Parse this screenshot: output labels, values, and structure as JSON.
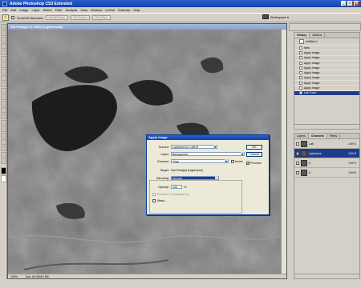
{
  "app": {
    "title": "Adobe Photoshop CS3 Extended",
    "window_controls": [
      "_",
      "□",
      "x"
    ]
  },
  "menu": [
    "File",
    "Edit",
    "Image",
    "Layer",
    "Select",
    "Filter",
    "Analysis",
    "View",
    "Window",
    "onOne",
    "Extensis",
    "Help"
  ],
  "options": {
    "scroll_all_windows": "Scroll All Windows",
    "actual_pixels": "Actual Pixels",
    "fit_screen": "Fit Screen",
    "print_size": "Print Size",
    "workspace": "Workspace ▾"
  },
  "document": {
    "title": "Sat Finaljpd @ 100% (Lightness/8)",
    "status_zoom": "100%",
    "status_doc": "Doc: 63.2M/8.13M"
  },
  "dialog": {
    "title": "Apply Image",
    "source_label": "Source:",
    "source_value": "Lightness for LAB.tif",
    "layer_label": "Layer:",
    "layer_value": "Background",
    "channel_label": "Channel:",
    "channel_value": "Gray",
    "invert_label": "Invert",
    "target_label": "Target:",
    "target_value": "Sat Finaljpd (Lightness)",
    "blending_label": "Blending:",
    "blending_value": "Normal",
    "opacity_label": "Opacity:",
    "opacity_value": "100",
    "opacity_unit": "%",
    "preserve_label": "Preserve Transparency",
    "mask_label": "Mask...",
    "ok": "OK",
    "cancel": "Cancel",
    "preview_label": "Preview"
  },
  "history_panel": {
    "tabs": [
      "History",
      "Actions"
    ],
    "snapshot": "Untitled-1",
    "items": [
      "New",
      "Apply Image",
      "Apply Image",
      "Apply Image",
      "Apply Image",
      "Apply Image",
      "Apply Image",
      "Apply Image",
      "Apply Image",
      "Lab Color"
    ],
    "selected_index": 9
  },
  "channels_panel": {
    "tabs": [
      "Layers",
      "Channels",
      "Paths"
    ],
    "rows": [
      {
        "name": "Lab",
        "key": "Ctrl+2"
      },
      {
        "name": "Lightness",
        "key": "Ctrl+3"
      },
      {
        "name": "a",
        "key": "Ctrl+4"
      },
      {
        "name": "b",
        "key": "Ctrl+5"
      }
    ],
    "selected_index": 1
  },
  "colors": {
    "accent": "#1f3c8c",
    "titlebar": "#1441a8"
  }
}
